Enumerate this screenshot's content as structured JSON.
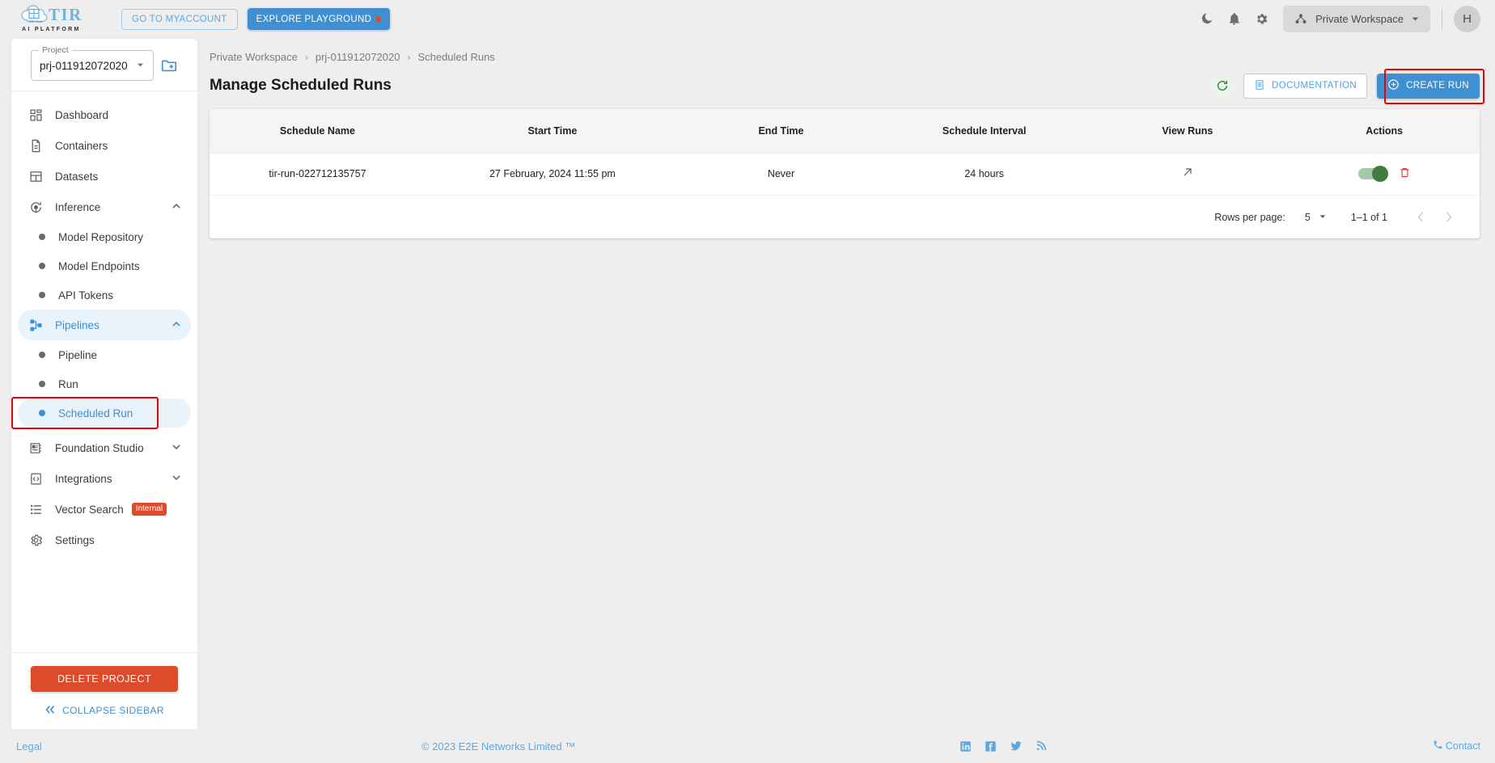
{
  "topbar": {
    "logo_text": "TIR",
    "logo_subtext": "AI PLATFORM",
    "myaccount_label": "GO TO MYACCOUNT",
    "playground_label": "EXPLORE PLAYGROUND",
    "workspace_label": "Private Workspace",
    "avatar_initial": "H",
    "icons": {
      "theme": "moon-icon",
      "notifications": "bell-icon",
      "settings": "gear-icon",
      "workspace": "workspace-icon",
      "caret": "chevron-down-icon"
    }
  },
  "sidebar": {
    "project_label": "Project",
    "project_value": "prj-011912072020",
    "new_project_icon": "new-folder-icon",
    "items": [
      {
        "label": "Dashboard",
        "icon": "dashboard-icon",
        "type": "item"
      },
      {
        "label": "Containers",
        "icon": "document-icon",
        "type": "item"
      },
      {
        "label": "Datasets",
        "icon": "grid-icon",
        "type": "item"
      },
      {
        "label": "Inference",
        "icon": "inference-icon",
        "type": "group",
        "expanded": true
      },
      {
        "label": "Model Repository",
        "type": "sub"
      },
      {
        "label": "Model Endpoints",
        "type": "sub"
      },
      {
        "label": "API Tokens",
        "type": "sub"
      },
      {
        "label": "Pipelines",
        "icon": "pipeline-icon",
        "type": "group",
        "expanded": true,
        "active": true
      },
      {
        "label": "Pipeline",
        "type": "sub"
      },
      {
        "label": "Run",
        "type": "sub"
      },
      {
        "label": "Scheduled Run",
        "type": "sub",
        "selected": true,
        "highlighted": true
      },
      {
        "label": "Foundation Studio",
        "icon": "studio-icon",
        "type": "group",
        "expanded": false
      },
      {
        "label": "Integrations",
        "icon": "code-icon",
        "type": "group",
        "expanded": false
      },
      {
        "label": "Vector Search",
        "icon": "list-icon",
        "type": "item",
        "badge": "Internal"
      },
      {
        "label": "Settings",
        "icon": "gear-icon",
        "type": "item"
      }
    ],
    "delete_project_label": "DELETE PROJECT",
    "collapse_label": "COLLAPSE SIDEBAR"
  },
  "main": {
    "breadcrumb": [
      "Private Workspace",
      "prj-011912072020",
      "Scheduled Runs"
    ],
    "page_title": "Manage Scheduled Runs",
    "refresh_icon": "refresh-icon",
    "documentation_label": "DOCUMENTATION",
    "create_run_label": "CREATE RUN"
  },
  "table": {
    "columns": [
      "Schedule Name",
      "Start Time",
      "End Time",
      "Schedule Interval",
      "View Runs",
      "Actions"
    ],
    "rows": [
      {
        "schedule_name": "tir-run-022712135757",
        "start_time": "27 February, 2024 11:55 pm",
        "end_time": "Never",
        "schedule_interval": "24 hours",
        "view_runs_icon": "external-link-icon",
        "toggle_on": true,
        "delete_icon": "trash-icon"
      }
    ],
    "pagination": {
      "rows_per_page_label": "Rows per page:",
      "rows_per_page_value": "5",
      "range_label": "1–1 of 1",
      "prev_icon": "chevron-left-icon",
      "next_icon": "chevron-right-icon"
    }
  },
  "footer": {
    "legal": "Legal",
    "copyright": "© 2023 E2E Networks Limited ™",
    "social": [
      "linkedin-icon",
      "facebook-icon",
      "twitter-icon",
      "rss-icon"
    ],
    "contact": "Contact"
  },
  "colors": {
    "accent": "#3f8fd1",
    "danger": "#dd4b2b",
    "success": "#3f7d3f",
    "highlight": "#f20000",
    "link": "#5aa9e6"
  }
}
